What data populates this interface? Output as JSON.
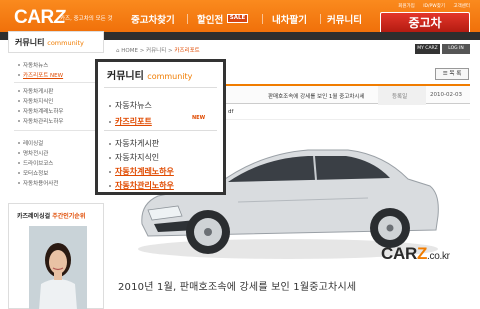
{
  "header": {
    "logo_main": "CAR",
    "logo_z": "Z",
    "logo_sub": "카즈, 중고차의 모든 것",
    "nav": [
      "중고차찾기",
      "할인전",
      "내차팔기",
      "커뮤니티"
    ],
    "sale_badge": "SALE",
    "util_links": [
      "회원가입",
      "ID/PW찾기",
      "고객센터"
    ],
    "used_car_button": "중고차",
    "colors": {
      "primary_orange": "#ee6a05",
      "accent_red": "#c62014"
    }
  },
  "sidebar": {
    "title": "커뮤니티",
    "title_en": "community",
    "groups": [
      [
        "자동차뉴스",
        "카즈리포트 NEW"
      ],
      [
        "자동차게시판",
        "자동차지식인",
        "자동차계레노하우",
        "자동차관리노하우"
      ],
      [
        "레이싱걸",
        "명차전시관",
        "드라이브코스",
        "모터쇼정보",
        "자동차용어사전"
      ]
    ],
    "popular_title": "카즈레이싱걸",
    "popular_title_highlight": "주간인기순위"
  },
  "main": {
    "breadcrumb": {
      "home": "HOME",
      "sep1": ">",
      "community": "커뮤니티",
      "sep2": ">",
      "current": "카즈리포트"
    },
    "my_carz": "MY CARZ",
    "login": "LOG IN",
    "list_button": "목 록",
    "article": {
      "row_title": "판매호조속에 강세를 보인 1월 중고차시세",
      "date_label": "등록일",
      "date": "2010-02-03",
      "file_label": "df",
      "headline": "2010년 1월, 판매호조속에 강세를 보인 1월중고차시세"
    },
    "watermark": {
      "pre": "CAR",
      "z": "Z",
      "suffix": ".co.kr"
    }
  },
  "dropdown": {
    "title": "커뮤니티",
    "title_en": "community",
    "items_top": [
      "자동차뉴스",
      "카즈리포트"
    ],
    "new_badge": "NEW",
    "items_bottom": [
      "자동차게시판",
      "자동차지식인",
      "자동차계레노하우",
      "자동차관리노하우"
    ]
  }
}
